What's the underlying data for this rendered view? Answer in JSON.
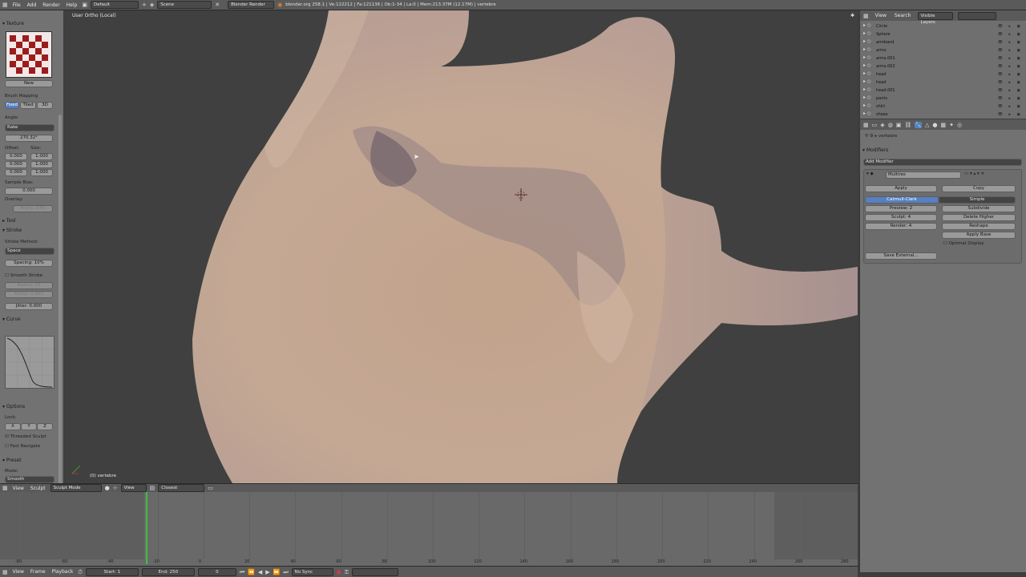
{
  "topbar": {
    "menus": [
      "File",
      "Add",
      "Render",
      "Help"
    ],
    "layout": "Default",
    "scene": "Scene",
    "engine": "Blender Render",
    "stats": "blender.org 258.1 | Ve:122212 | Fa:121136 | Ob:1-34 | La:0 | Mem:213.37M (12.17M) | vertebre"
  },
  "toolshelf": {
    "panel_texture": "Texture",
    "tex_new": "New",
    "brush_mapping": "Brush Mapping",
    "mapping_opts": [
      "Fixed",
      "Tiled",
      "3D"
    ],
    "angle_label": "Angle:",
    "angle_select": "Rake",
    "angle_value": "270.32°",
    "offset_label": "Offset:",
    "size_label": "Size:",
    "offset_vals": [
      "0.000",
      "0.000",
      "0.000"
    ],
    "size_vals": [
      "1.000",
      "1.000",
      "1.000"
    ],
    "sample_bias_label": "Sample Bias:",
    "sample_bias": "0.000",
    "overlay_label": "Overlay:",
    "overlay_val": "Alpha: 33%",
    "panel_tool": "Tool",
    "panel_stroke": "Stroke",
    "stroke_method_label": "Stroke Method:",
    "stroke_method": "Space",
    "spacing": "Spacing: 10%",
    "smooth_stroke": "Smooth Stroke",
    "radius": "Radius: 75",
    "factor": "Factor: 0.900",
    "jitter": "Jitter: 0.000",
    "panel_curve": "Curve",
    "panel_options": "Options",
    "lock_label": "Lock:",
    "lock_axes": [
      "X",
      "Y",
      "Z"
    ],
    "threaded_sculpt": "Threaded Sculpt",
    "fast_navigate": "Fast Navigate",
    "panel_preset": "Preset",
    "mode_label": "Mode:",
    "mode_val": "Smooth"
  },
  "viewport": {
    "view_label": "User Ortho (Local)",
    "object_label": "(0) vertebre"
  },
  "viewport_header": {
    "menus": [
      "View",
      "Sculpt"
    ],
    "mode": "Sculpt Mode",
    "view_menu": "View",
    "pivot": "Closest"
  },
  "outliner": {
    "menus": [
      "View",
      "Search"
    ],
    "filter": "Visible Layers",
    "items": [
      "Circle",
      "Sphere",
      "armband",
      "arms",
      "arms.001",
      "arms.002",
      "head",
      "head",
      "head.001",
      "pants",
      "shirt",
      "shoes"
    ]
  },
  "properties": {
    "object_path": "vertebre",
    "section": "Modifiers",
    "add_modifier": "Add Modifier",
    "modifier_name": "Multires",
    "apply": "Apply",
    "copy": "Copy",
    "subdiv_types": [
      "Catmull-Clark",
      "Simple"
    ],
    "preview": "Preview: 2",
    "sculpt": "Sculpt: 4",
    "render": "Render: 4",
    "subdivide": "Subdivide",
    "delete_higher": "Delete Higher",
    "reshape": "Reshape",
    "apply_base": "Apply Base",
    "optimal_display": "Optimal Display",
    "save_external": "Save External..."
  },
  "timeline": {
    "ticks": [
      "-80",
      "-60",
      "-40",
      "-20",
      "0",
      "20",
      "40",
      "60",
      "80",
      "100",
      "120",
      "140",
      "160",
      "180",
      "200",
      "220",
      "240",
      "260",
      "280"
    ],
    "footer_menus": [
      "View",
      "Frame",
      "Playback"
    ],
    "start": "Start: 1",
    "end": "End: 250",
    "current": "0",
    "sync": "No Sync"
  },
  "colors": {
    "accent": "#5680c2",
    "bg": "#404040",
    "mesh_skin": "#c8a89a"
  }
}
